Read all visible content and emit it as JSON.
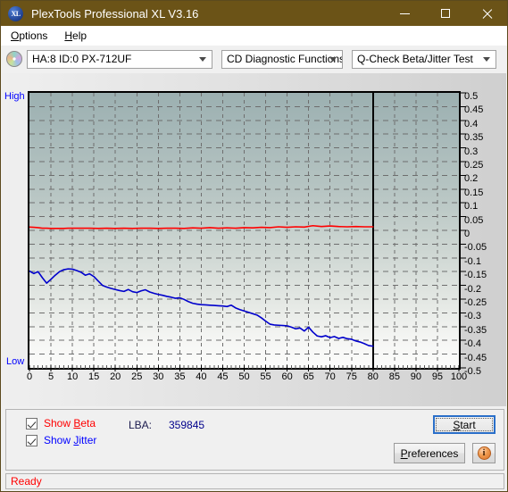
{
  "window": {
    "title": "PlexTools Professional XL V3.16",
    "app_icon": "xl-disc-icon",
    "minimize_label": "Minimize",
    "maximize_label": "Maximize",
    "close_label": "Close",
    "titlebar_color": "#6b5317"
  },
  "menu": {
    "items": [
      {
        "label": "Options",
        "accel": "O"
      },
      {
        "label": "Help",
        "accel": "H"
      }
    ]
  },
  "toolbar": {
    "drive_icon": "optical-disc-icon",
    "drive_combo": {
      "value": "HA:8 ID:0  PX-712UF",
      "options": [
        "HA:8 ID:0  PX-712UF"
      ]
    },
    "function_combo": {
      "value": "CD Diagnostic Functions",
      "options": [
        "CD Diagnostic Functions"
      ]
    },
    "test_combo": {
      "value": "Q-Check Beta/Jitter Test",
      "options": [
        "Q-Check Beta/Jitter Test"
      ]
    }
  },
  "chart_data": {
    "type": "line",
    "title": "Q-Check Beta/Jitter Test",
    "xlabel": "",
    "ylabel": "",
    "xlim": [
      0,
      100
    ],
    "ylim": [
      -0.5,
      0.5
    ],
    "grid": true,
    "legend_position": "bottom-left",
    "y_axis_side": "right",
    "left_top_label": "High",
    "left_bottom_label": "Low",
    "data_end_marker_x": 80,
    "xticks": [
      0,
      5,
      10,
      15,
      20,
      25,
      30,
      35,
      40,
      45,
      50,
      55,
      60,
      65,
      70,
      75,
      80,
      85,
      90,
      95,
      100
    ],
    "yticks": [
      0.5,
      0.45,
      0.4,
      0.35,
      0.3,
      0.25,
      0.2,
      0.15,
      0.1,
      0.05,
      0,
      -0.05,
      -0.1,
      -0.15,
      -0.2,
      -0.25,
      -0.3,
      -0.35,
      -0.4,
      -0.45,
      -0.5
    ],
    "series": [
      {
        "name": "Beta",
        "color": "#ff0000",
        "x": [
          0,
          1,
          2,
          3,
          4,
          5,
          6,
          7,
          8,
          9,
          10,
          12,
          14,
          16,
          18,
          20,
          22,
          24,
          26,
          28,
          30,
          32,
          34,
          36,
          38,
          40,
          42,
          44,
          46,
          48,
          50,
          52,
          54,
          56,
          58,
          60,
          62,
          64,
          66,
          68,
          70,
          72,
          74,
          76,
          78,
          80
        ],
        "values": [
          0.012,
          0.011,
          0.01,
          0.008,
          0.008,
          0.007,
          0.007,
          0.007,
          0.007,
          0.008,
          0.008,
          0.008,
          0.008,
          0.007,
          0.008,
          0.007,
          0.008,
          0.007,
          0.008,
          0.008,
          0.007,
          0.008,
          0.008,
          0.007,
          0.009,
          0.008,
          0.01,
          0.008,
          0.009,
          0.008,
          0.01,
          0.009,
          0.011,
          0.01,
          0.013,
          0.011,
          0.013,
          0.012,
          0.017,
          0.014,
          0.016,
          0.014,
          0.013,
          0.014,
          0.013,
          0.013
        ]
      },
      {
        "name": "Jitter",
        "color": "#0000cc",
        "x": [
          0,
          1,
          2,
          3,
          4,
          5,
          6,
          7,
          8,
          9,
          10,
          11,
          12,
          13,
          14,
          15,
          16,
          17,
          18,
          19,
          20,
          21,
          22,
          23,
          24,
          25,
          26,
          27,
          28,
          29,
          30,
          31,
          32,
          33,
          34,
          35,
          36,
          37,
          38,
          39,
          40,
          41,
          42,
          43,
          44,
          45,
          46,
          47,
          48,
          49,
          50,
          51,
          52,
          53,
          54,
          55,
          56,
          57,
          58,
          59,
          60,
          61,
          62,
          63,
          64,
          65,
          66,
          67,
          68,
          69,
          70,
          71,
          72,
          73,
          74,
          75,
          76,
          77,
          78,
          79,
          80
        ],
        "values": [
          -0.148,
          -0.157,
          -0.15,
          -0.172,
          -0.192,
          -0.178,
          -0.163,
          -0.15,
          -0.143,
          -0.14,
          -0.141,
          -0.146,
          -0.152,
          -0.163,
          -0.158,
          -0.168,
          -0.184,
          -0.2,
          -0.206,
          -0.211,
          -0.215,
          -0.219,
          -0.222,
          -0.215,
          -0.223,
          -0.226,
          -0.22,
          -0.216,
          -0.224,
          -0.229,
          -0.233,
          -0.236,
          -0.24,
          -0.243,
          -0.247,
          -0.245,
          -0.251,
          -0.259,
          -0.265,
          -0.268,
          -0.27,
          -0.271,
          -0.272,
          -0.273,
          -0.274,
          -0.275,
          -0.277,
          -0.272,
          -0.282,
          -0.288,
          -0.293,
          -0.298,
          -0.303,
          -0.308,
          -0.318,
          -0.33,
          -0.341,
          -0.344,
          -0.345,
          -0.346,
          -0.347,
          -0.352,
          -0.358,
          -0.355,
          -0.366,
          -0.352,
          -0.37,
          -0.384,
          -0.387,
          -0.383,
          -0.39,
          -0.386,
          -0.393,
          -0.389,
          -0.394,
          -0.396,
          -0.402,
          -0.406,
          -0.412,
          -0.419,
          -0.421
        ]
      }
    ]
  },
  "controls": {
    "show_beta": {
      "label_prefix": "Show ",
      "label_accel": "B",
      "label_suffix": "eta",
      "checked": true,
      "color": "#ff0000"
    },
    "show_jitter": {
      "label_prefix": "Show ",
      "label_accel": "J",
      "label_suffix": "itter",
      "checked": true,
      "color": "#0000ff"
    },
    "lba_label": "LBA:",
    "lba_value": "359845",
    "start_button": {
      "prefix": "",
      "accel": "S",
      "suffix": "tart"
    },
    "preferences_button": {
      "prefix": "",
      "accel": "P",
      "suffix": "references"
    },
    "info_button": {
      "icon": "info-icon",
      "glyph": "i"
    }
  },
  "status": {
    "text": "Ready",
    "color": "#ff0000"
  }
}
